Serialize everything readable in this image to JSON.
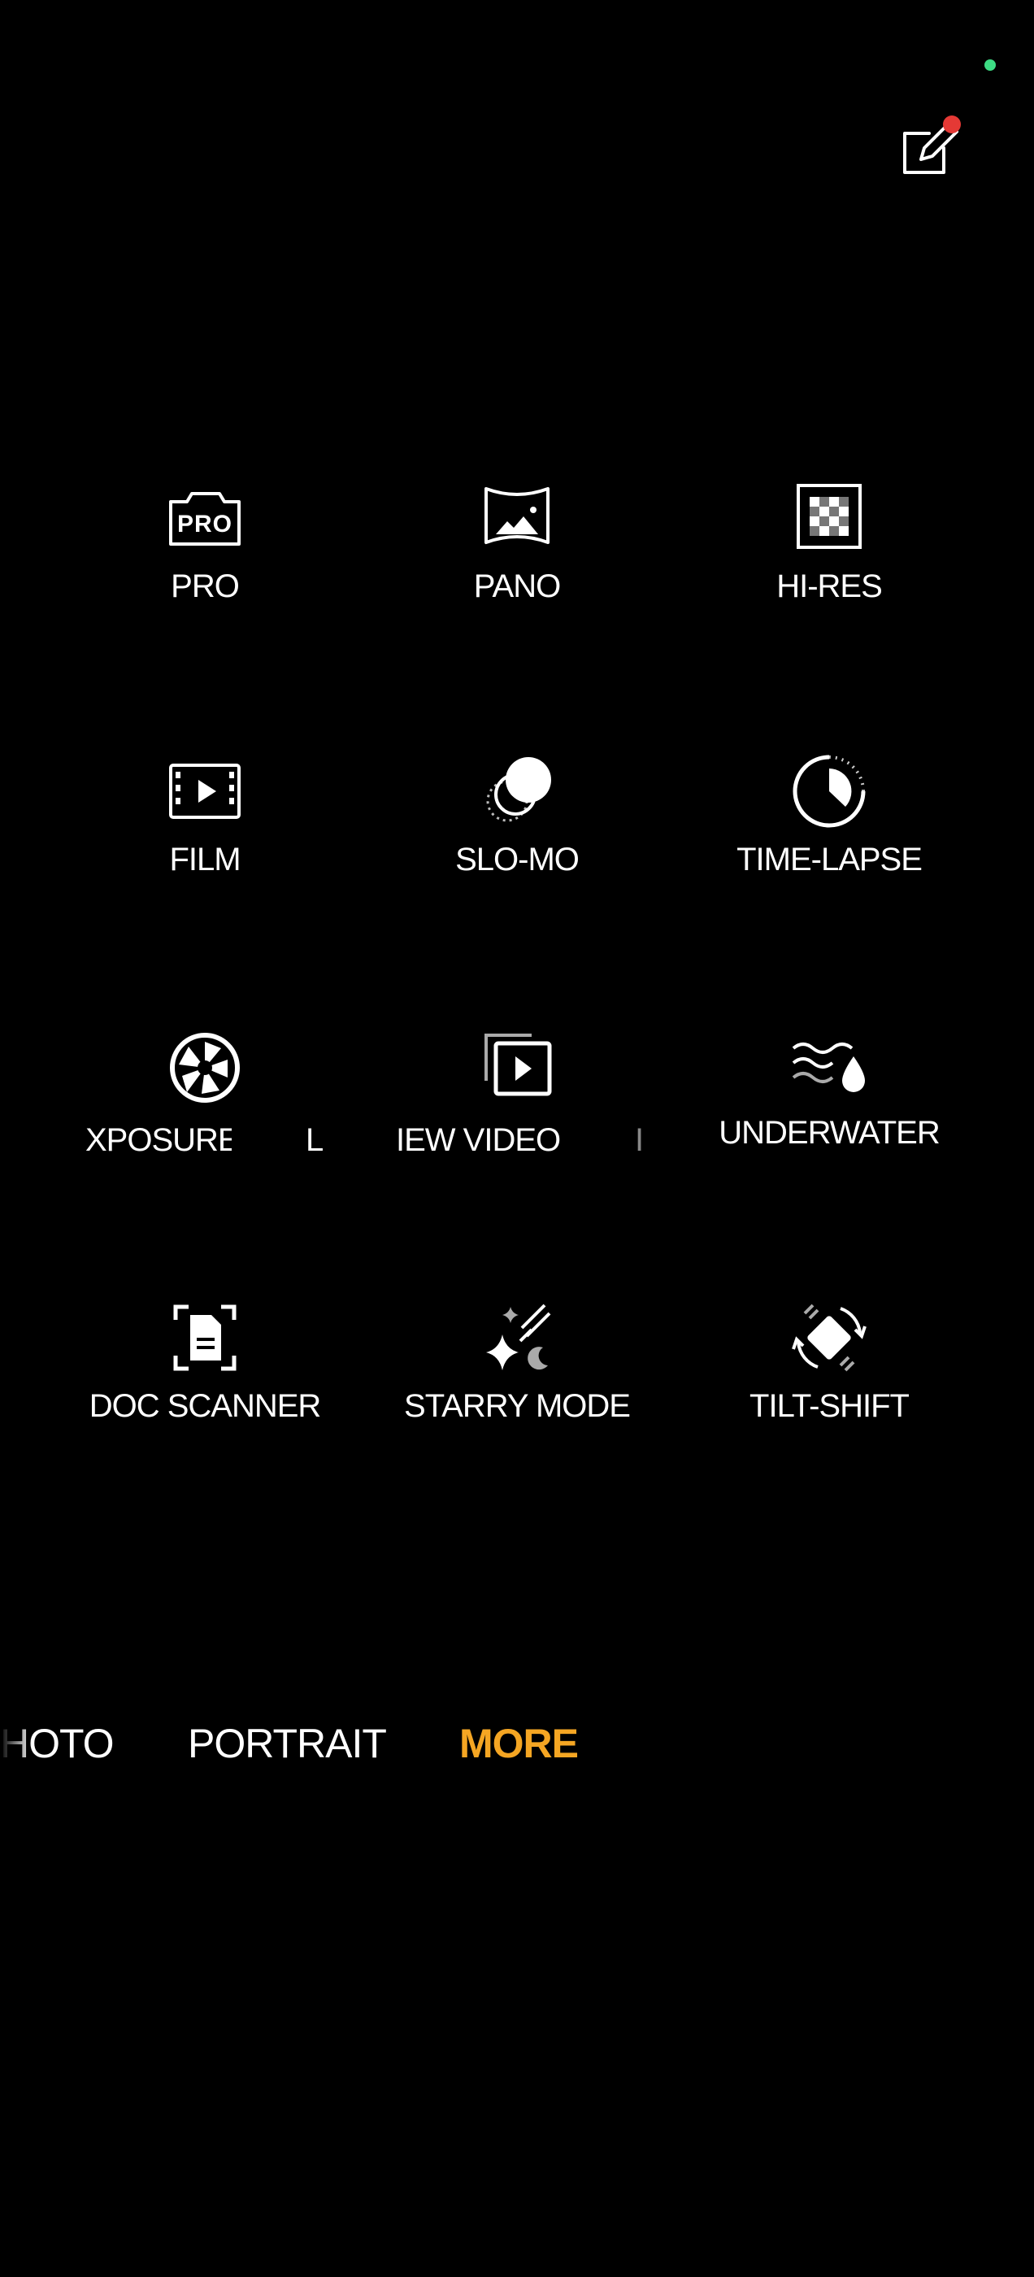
{
  "colors": {
    "background": "#000000",
    "text": "#ffffff",
    "accent": "#F5A623",
    "notification_dot": "#E53935",
    "status_dot": "#3DDC84"
  },
  "top_bar": {
    "status_indicator": "green-dot",
    "edit_button_icon": "edit-icon"
  },
  "modes": [
    {
      "label": "PRO",
      "icon": "pro-camera-icon"
    },
    {
      "label": "PANO",
      "icon": "panorama-icon"
    },
    {
      "label": "HI-RES",
      "icon": "hi-res-icon"
    },
    {
      "label": "FILM",
      "icon": "film-icon"
    },
    {
      "label": "SLO-MO",
      "icon": "slow-motion-icon"
    },
    {
      "label": "TIME-LAPSE",
      "icon": "time-lapse-icon"
    },
    {
      "label": "XPOSURE",
      "icon": "aperture-icon"
    },
    {
      "label": "L",
      "icon": ""
    },
    {
      "label": "IEW VIDEO",
      "icon": "video-playback-icon"
    },
    {
      "label": "I",
      "icon": ""
    },
    {
      "label": "UNDERWATER",
      "icon": "underwater-icon"
    },
    {
      "label": "DOC SCANNER",
      "icon": "document-scan-icon"
    },
    {
      "label": "STARRY MODE",
      "icon": "starry-icon"
    },
    {
      "label": "TILT-SHIFT",
      "icon": "tilt-shift-icon"
    }
  ],
  "mode_bar": {
    "tabs": [
      {
        "label": "HOTO",
        "state": "partial"
      },
      {
        "label": "PORTRAIT",
        "state": "normal"
      },
      {
        "label": "MORE",
        "state": "selected"
      }
    ]
  }
}
